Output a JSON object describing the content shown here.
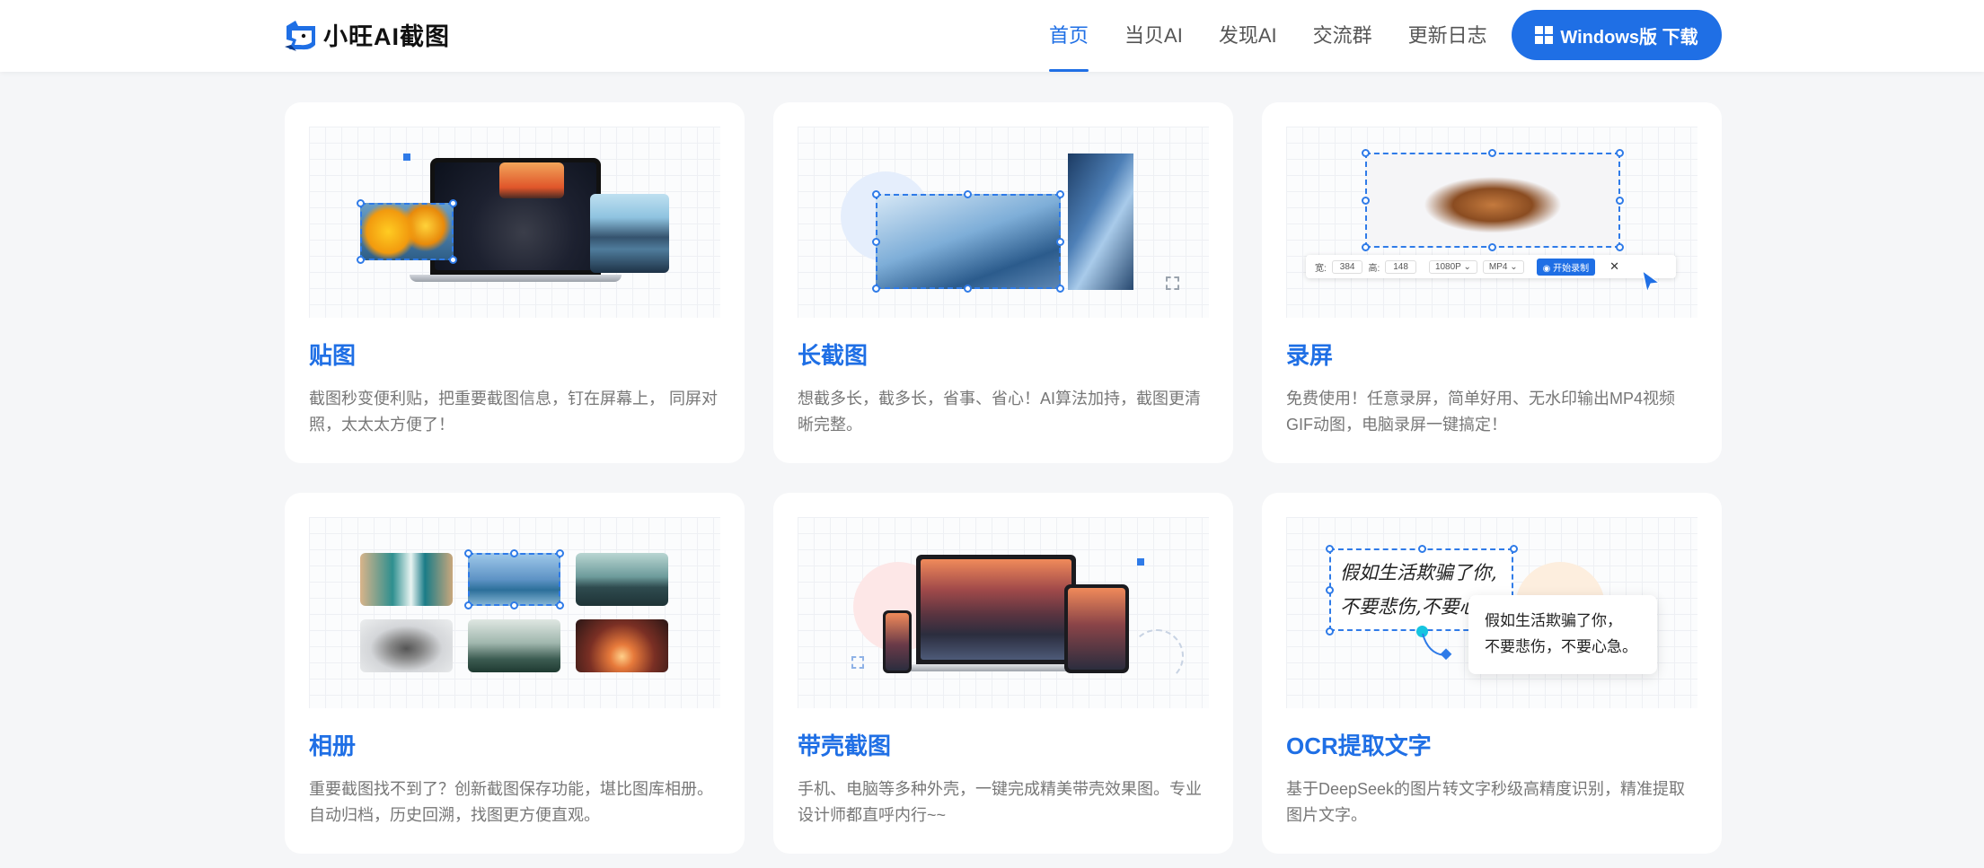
{
  "header": {
    "logo_text": "小旺AI截图",
    "nav": [
      {
        "label": "首页",
        "active": true
      },
      {
        "label": "当贝AI",
        "active": false
      },
      {
        "label": "发现AI",
        "active": false
      },
      {
        "label": "交流群",
        "active": false
      },
      {
        "label": "更新日志",
        "active": false
      }
    ],
    "download_label": "Windows版 下载",
    "accent_color": "#1f6fe5"
  },
  "cards": [
    {
      "title": "贴图",
      "desc": "截图秒变便利贴，把重要截图信息，钉在屏幕上， 同屏对照，太太太方便了！"
    },
    {
      "title": "长截图",
      "desc": "想截多长，截多长，省事、省心！AI算法加持，截图更清晰完整。"
    },
    {
      "title": "录屏",
      "desc": "免费使用！任意录屏，简单好用、无水印输出MP4视频GIF动图，电脑录屏一键搞定！"
    },
    {
      "title": "相册",
      "desc": "重要截图找不到了？创新截图保存功能，堪比图库相册。自动归档，历史回溯，找图更方便直观。"
    },
    {
      "title": "带壳截图",
      "desc": "手机、电脑等多种外壳，一键完成精美带壳效果图。专业设计师都直呼内行~~"
    },
    {
      "title": "OCR提取文字",
      "desc": "基于DeepSeek的图片转文字秒级高精度识别，精准提取图片文字。"
    }
  ],
  "record_toolbar": {
    "width_label": "宽:",
    "width_value": "384",
    "height_label": "高:",
    "height_value": "148",
    "resolution": "1080P",
    "format": "MP4",
    "start_label": "开始录制"
  },
  "ocr_demo": {
    "handwriting_line1": "假如生活欺骗了你,",
    "handwriting_line2": "不要悲伤,不要心",
    "result_line1": "假如生活欺骗了你，",
    "result_line2": "不要悲伤，不要心急。"
  }
}
